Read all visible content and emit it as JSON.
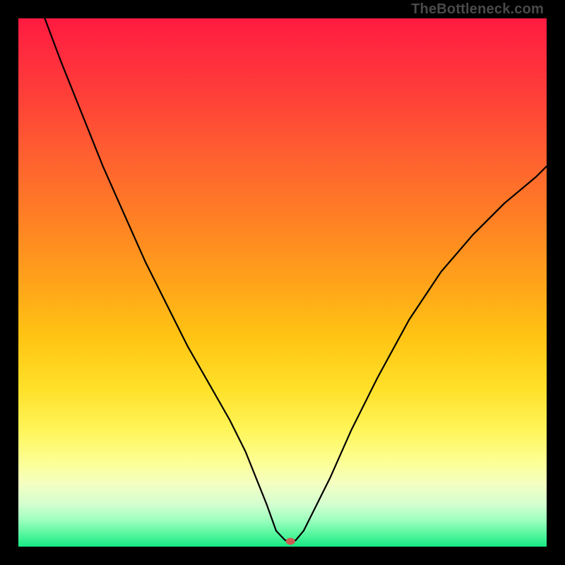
{
  "watermark": {
    "text": "TheBottleneck.com"
  },
  "colors": {
    "gradient_css": "linear-gradient(to bottom, #ff1a40 0%, #ff2a3e 6%, #ff4038 15%, #ff6030 26%, #ff8024 38%, #ffa31a 50%, #ffc313 60%, #ffe028 70%, #fff55a 78%, #fcff95 84%, #f4ffc0 88%, #d4ffd0 92%, #9cffbe 95%, #4cf59a 98%, #16e884 100%)",
    "marker_hex": "#cc5b52",
    "curve_hex": "#000000"
  },
  "chart_data": {
    "type": "line",
    "title": "",
    "xlabel": "",
    "ylabel": "",
    "xlim": [
      0,
      100
    ],
    "ylim": [
      0,
      100
    ],
    "grid": false,
    "legend": false,
    "series": [
      {
        "name": "bottleneck-curve",
        "x": [
          5,
          8,
          12,
          16,
          20,
          24,
          28,
          32,
          36,
          40,
          43,
          45,
          47,
          48.8,
          50.5,
          51.5,
          52.5,
          54,
          56,
          59,
          63,
          68,
          74,
          80,
          86,
          92,
          98,
          100
        ],
        "y": [
          100,
          92,
          82,
          72,
          63,
          54,
          46,
          38,
          31,
          24,
          18,
          13,
          8,
          3,
          1.2,
          1.0,
          1.2,
          3,
          7,
          13,
          22,
          32,
          43,
          52,
          59,
          65,
          70,
          72
        ]
      }
    ],
    "markers": [
      {
        "name": "optimum-point",
        "x": 51.5,
        "y": 1.0
      }
    ]
  }
}
